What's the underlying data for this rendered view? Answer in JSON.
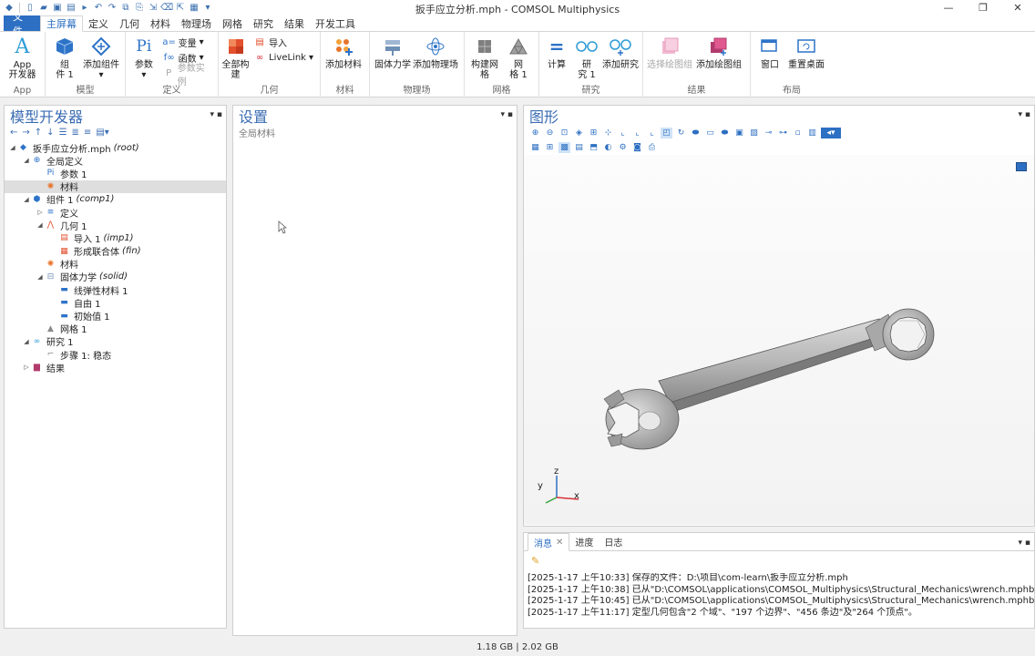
{
  "window": {
    "title": "扳手应立分析.mph - COMSOL Multiphysics"
  },
  "menu": {
    "file": "文件",
    "items": [
      "主屏幕",
      "定义",
      "几何",
      "材料",
      "物理场",
      "网格",
      "研究",
      "结果",
      "开发工具"
    ]
  },
  "ribbon": {
    "app": {
      "btn1": "App",
      "btn1b": "开发器",
      "label": "App"
    },
    "model": {
      "component": "组",
      "component2": "件 1",
      "add_component": "添加组件",
      "label": "模型"
    },
    "definitions": {
      "params": "参数",
      "vars": "变量",
      "funcs": "函数",
      "param_case": "参数实例",
      "label": "定义"
    },
    "geometry": {
      "build_all": "全部构建",
      "import": "导入",
      "livelink": "LiveLink",
      "label": "几何"
    },
    "materials": {
      "add_material": "添加材料",
      "label": "材料"
    },
    "physics": {
      "solid_mech": "固体力学",
      "add_physics": "添加物理场",
      "label": "物理场"
    },
    "mesh": {
      "build_mesh": "构建网格",
      "mesh": "网",
      "mesh2": "格 1",
      "label": "网格"
    },
    "study": {
      "compute": "计算",
      "study": "研",
      "study2": "究 1",
      "add_study": "添加研究",
      "label": "研究"
    },
    "results": {
      "select_plot": "选择绘图组",
      "add_plot": "添加绘图组",
      "label": "结果"
    },
    "layout": {
      "window": "窗口",
      "reset_desktop": "重置桌面",
      "label": "布局"
    }
  },
  "model_builder": {
    "title": "模型开发器",
    "tree": [
      {
        "indent": 0,
        "arrow": "◢",
        "icon": "mph-file-icon",
        "label": "扳手应立分析.mph",
        "tag": "(root)"
      },
      {
        "indent": 1,
        "arrow": "◢",
        "icon": "global-definitions-icon",
        "label": "全局定义",
        "tag": ""
      },
      {
        "indent": 2,
        "arrow": "",
        "icon": "parameters-icon",
        "label": "参数 1",
        "tag": ""
      },
      {
        "indent": 2,
        "arrow": "",
        "icon": "materials-icon",
        "label": "材料",
        "tag": "",
        "selected": true
      },
      {
        "indent": 1,
        "arrow": "◢",
        "icon": "component-icon",
        "label": "组件 1",
        "tag": "(comp1)"
      },
      {
        "indent": 2,
        "arrow": "▷",
        "icon": "definitions-icon",
        "label": "定义",
        "tag": ""
      },
      {
        "indent": 2,
        "arrow": "◢",
        "icon": "geometry-icon",
        "label": "几何 1",
        "tag": ""
      },
      {
        "indent": 3,
        "arrow": "",
        "icon": "import-icon",
        "label": "导入 1",
        "tag": "(imp1)"
      },
      {
        "indent": 3,
        "arrow": "",
        "icon": "form-union-icon",
        "label": "形成联合体",
        "tag": "(fin)"
      },
      {
        "indent": 2,
        "arrow": "",
        "icon": "materials-icon",
        "label": "材料",
        "tag": ""
      },
      {
        "indent": 2,
        "arrow": "◢",
        "icon": "solid-mechanics-icon",
        "label": "固体力学",
        "tag": "(solid)"
      },
      {
        "indent": 3,
        "arrow": "",
        "icon": "linear-elastic-icon",
        "label": "线弹性材料 1",
        "tag": ""
      },
      {
        "indent": 3,
        "arrow": "",
        "icon": "free-icon",
        "label": "自由 1",
        "tag": ""
      },
      {
        "indent": 3,
        "arrow": "",
        "icon": "initial-values-icon",
        "label": "初始值 1",
        "tag": ""
      },
      {
        "indent": 2,
        "arrow": "",
        "icon": "mesh-icon",
        "label": "网格 1",
        "tag": ""
      },
      {
        "indent": 1,
        "arrow": "◢",
        "icon": "study-icon",
        "label": "研究 1",
        "tag": ""
      },
      {
        "indent": 2,
        "arrow": "",
        "icon": "step-icon",
        "label": "步骤 1: 稳态",
        "tag": ""
      },
      {
        "indent": 1,
        "arrow": "▷",
        "icon": "results-icon",
        "label": "结果",
        "tag": ""
      }
    ]
  },
  "settings": {
    "title": "设置",
    "subtitle": "全局材料"
  },
  "graphics": {
    "title": "图形",
    "axes": {
      "x": "x",
      "y": "y",
      "z": "z"
    }
  },
  "messages": {
    "tabs": [
      "消息",
      "进度",
      "日志"
    ],
    "lines": [
      "[2025-1-17 上午10:33] 保存的文件：D:\\项目\\com-learn\\扳手应立分析.mph",
      "[2025-1-17 上午10:38] 已从\"D:\\COMSOL\\applications\\COMSOL_Multiphysics\\Structural_Mechanics\\wrench.mphbin\"导",
      "[2025-1-17 上午10:45] 已从\"D:\\COMSOL\\applications\\COMSOL_Multiphysics\\Structural_Mechanics\\wrench.mphbin\"导",
      "[2025-1-17 上午11:17] 定型几何包含\"2 个域\"、\"197 个边界\"、\"456 条边\"及\"264 个顶点\"。"
    ]
  },
  "status": {
    "memory": "1.18 GB | 2.02 GB"
  }
}
